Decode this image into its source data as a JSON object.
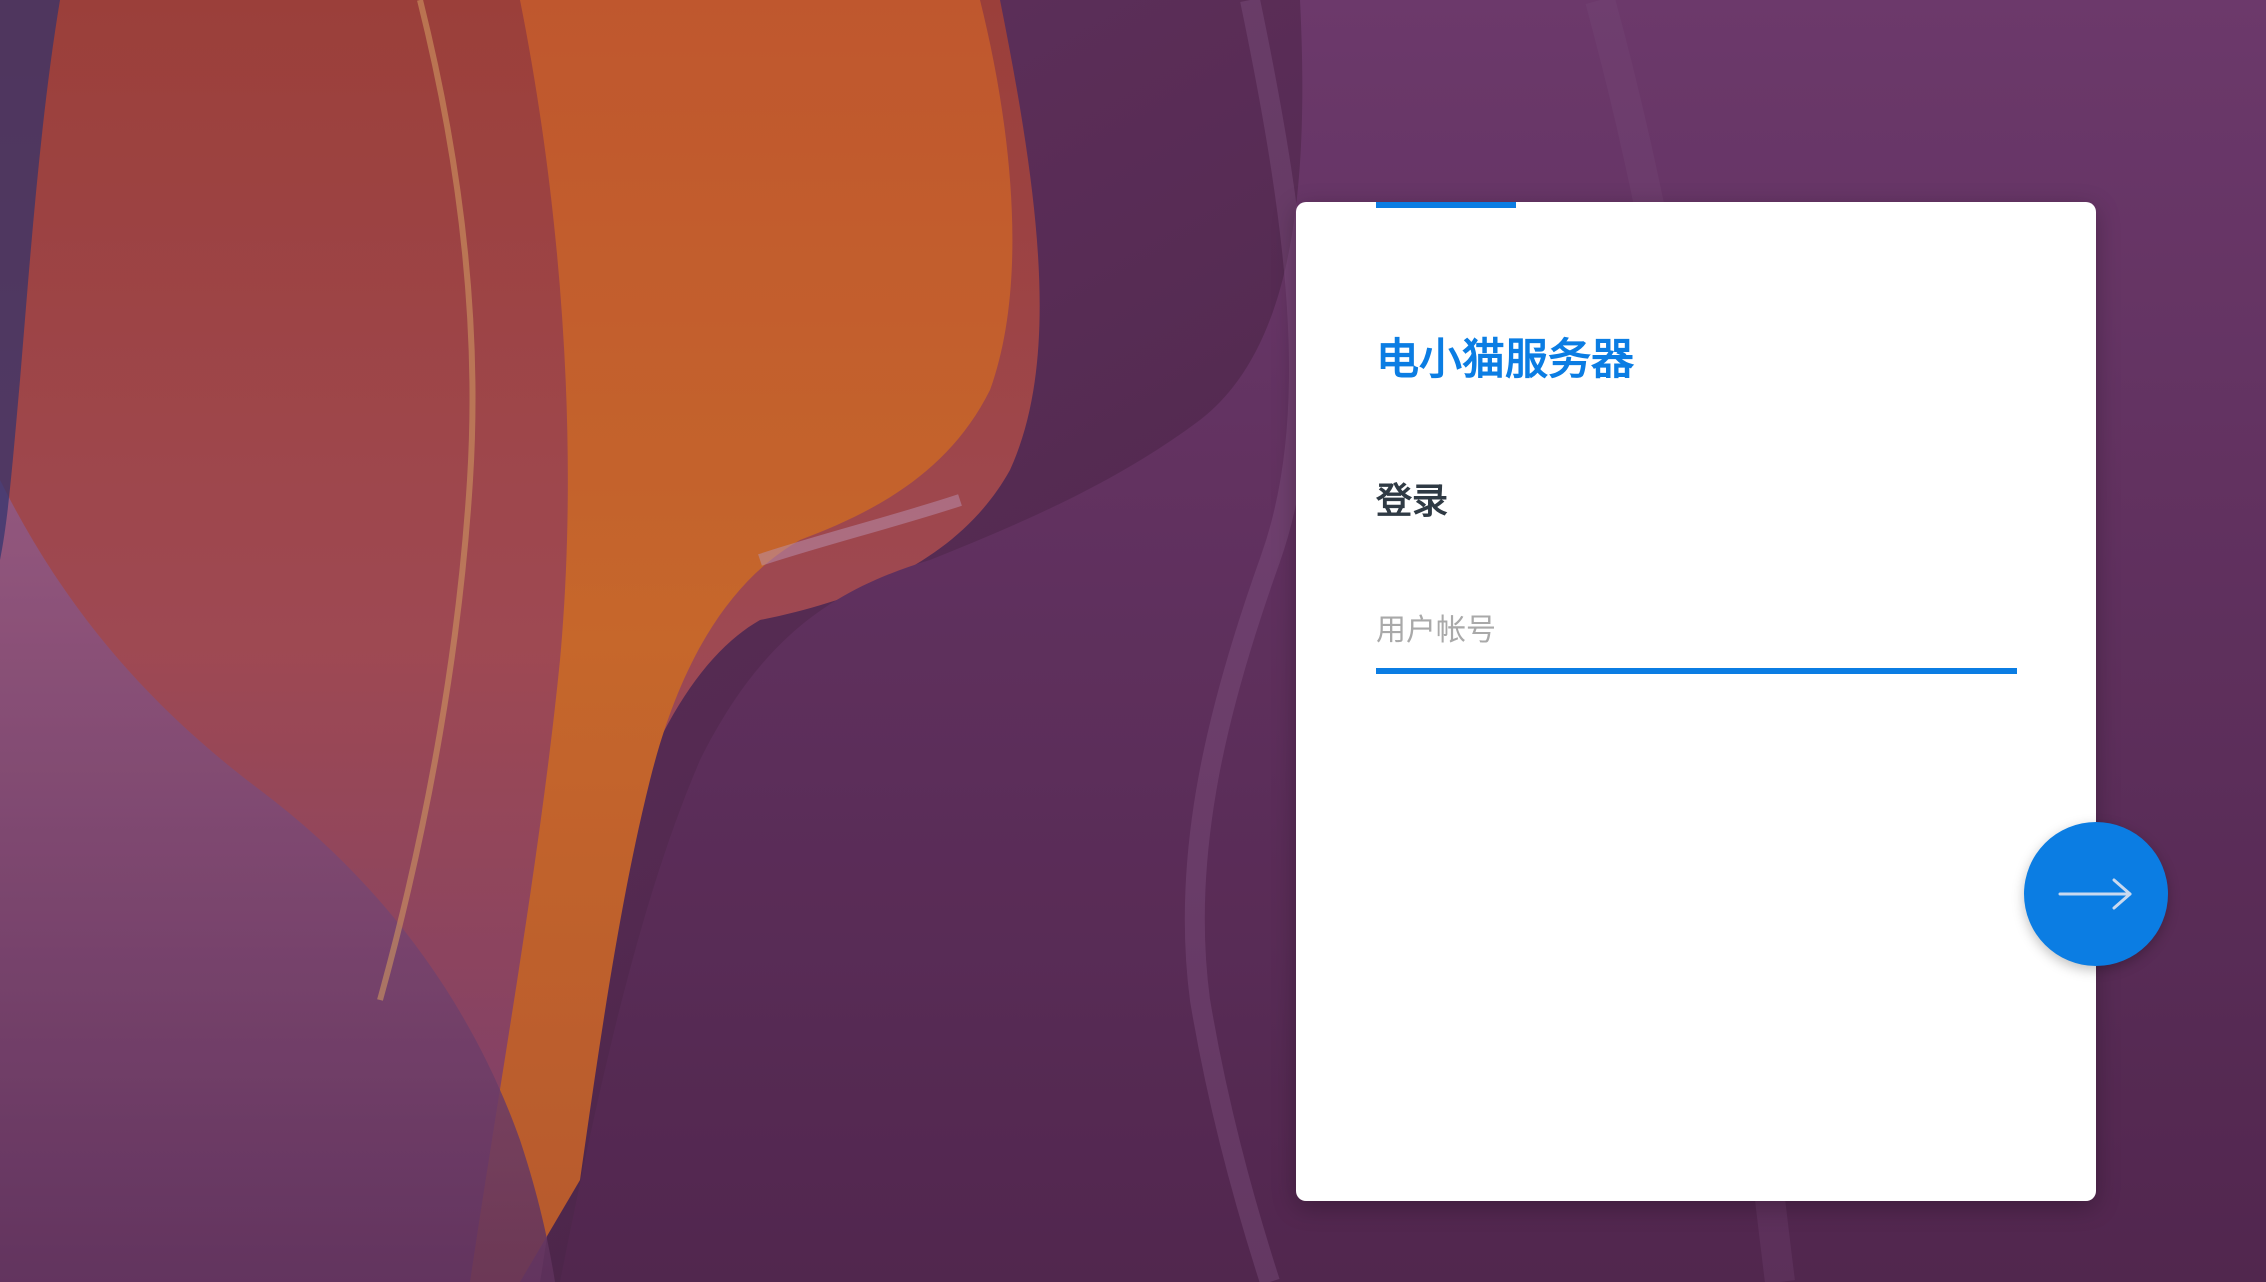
{
  "brand": {
    "title": "电小猫服务器"
  },
  "login": {
    "heading": "登录",
    "username_placeholder": "用户帐号",
    "username_value": ""
  },
  "actions": {
    "submit_icon": "arrow-right-icon"
  },
  "colors": {
    "accent": "#0b7de3",
    "heading": "#2f3a44",
    "placeholder": "#a9a9a9",
    "card_background": "#ffffff"
  },
  "background": {
    "description_icon": "canyon-wallpaper"
  }
}
